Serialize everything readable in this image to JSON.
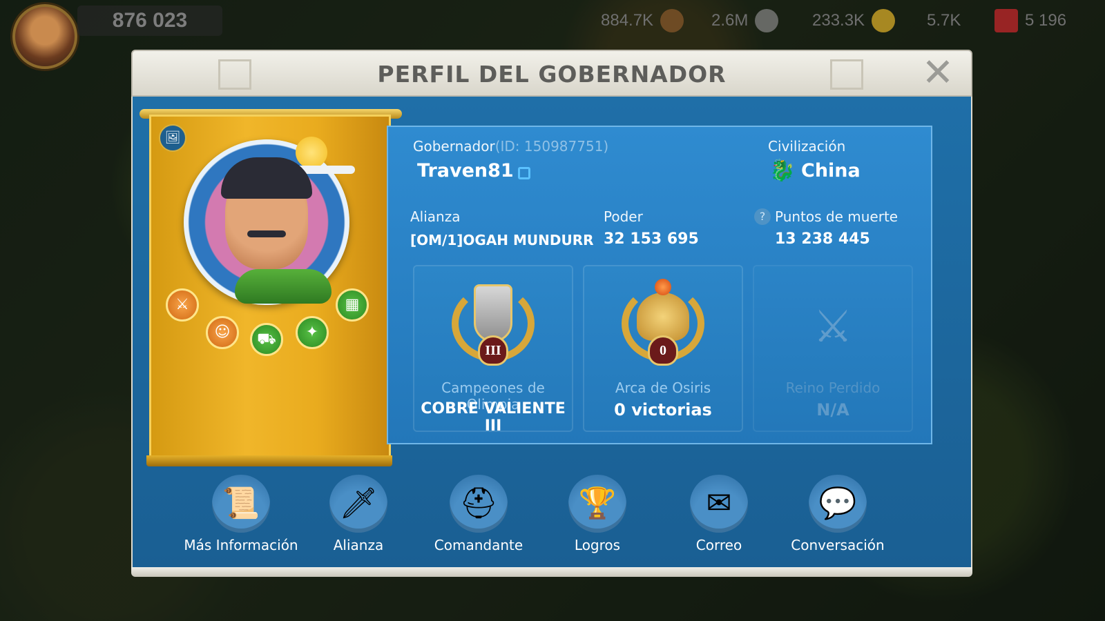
{
  "hud": {
    "power": "876 023",
    "resources": [
      {
        "icon": "food-icon",
        "value": "884.7K",
        "color": "#c9a13c"
      },
      {
        "icon": "wood-icon",
        "value": "2.6M",
        "color": "#8b5a2b"
      },
      {
        "icon": "stone-icon",
        "value": "233.3K",
        "color": "#888888"
      },
      {
        "icon": "gold-icon",
        "value": "5.7K",
        "color": "#e5b52a"
      },
      {
        "icon": "gem-icon",
        "value": "5 196",
        "color": "#d0262c"
      }
    ]
  },
  "dialog": {
    "title": "PERFIL DEL GOBERNADOR",
    "close": "✕"
  },
  "governor": {
    "label": "Gobernador",
    "id": "(ID: 150987751)",
    "name": "Traven81",
    "civ_label": "Civilización",
    "civ": "China",
    "alliance_label": "Alianza",
    "alliance": "[OM/1]OGAH MUNDURR",
    "power_label": "Poder",
    "power": "32 153 695",
    "kill_label": "Puntos de muerte",
    "kill": "13 238 445"
  },
  "cards": [
    {
      "label": "Campeones de Olimpia",
      "value": "COBRE VALIENTE III",
      "badge": "III",
      "locked": false
    },
    {
      "label": "Arca de Osiris",
      "value": "0 victorias",
      "badge": "0",
      "locked": false
    },
    {
      "label": "Reino Perdido",
      "value": "N/A",
      "locked": true
    }
  ],
  "nav": [
    {
      "label": "Más Información",
      "icon": "scroll-icon"
    },
    {
      "label": "Alianza",
      "icon": "alliance-sword-icon"
    },
    {
      "label": "Comandante",
      "icon": "helmet-icon"
    },
    {
      "label": "Logros",
      "icon": "trophy-icon"
    },
    {
      "label": "Correo",
      "icon": "mail-icon"
    },
    {
      "label": "Conversación",
      "icon": "chat-icon"
    }
  ],
  "colors": {
    "panel_blue": "#2377b9",
    "header": "#e5e3da",
    "banner_gold": "#e9ab1e"
  }
}
